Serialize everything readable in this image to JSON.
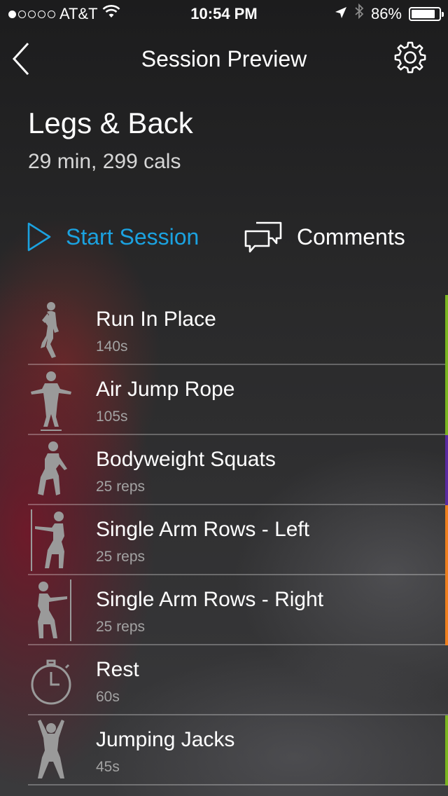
{
  "status_bar": {
    "signal_dots_filled": 1,
    "signal_dots_total": 5,
    "carrier": "AT&T",
    "time": "10:54 PM",
    "battery": "86%",
    "battery_level": 0.86
  },
  "nav": {
    "title": "Session Preview",
    "back_icon": "chevron-left-icon",
    "settings_icon": "gear-icon"
  },
  "workout": {
    "title": "Legs & Back",
    "meta": "29 min, 299 cals"
  },
  "actions": {
    "start_label": "Start Session",
    "comments_label": "Comments",
    "accent_color": "#1ba2e0"
  },
  "exercises": [
    {
      "name": "Run In Place",
      "detail": "140s",
      "figure": "running-figure-icon",
      "strip_color": "#7bb421"
    },
    {
      "name": "Air Jump Rope",
      "detail": "105s",
      "figure": "jump-rope-figure-icon",
      "strip_color": "#7bb421"
    },
    {
      "name": "Bodyweight Squats",
      "detail": "25 reps",
      "figure": "squat-figure-icon",
      "strip_color": "#5a2aa0"
    },
    {
      "name": "Single Arm Rows - Left",
      "detail": "25 reps",
      "figure": "row-left-figure-icon",
      "strip_color": "#ee7f1e"
    },
    {
      "name": "Single Arm Rows - Right",
      "detail": "25 reps",
      "figure": "row-right-figure-icon",
      "strip_color": "#ee7f1e"
    },
    {
      "name": "Rest",
      "detail": "60s",
      "figure": "stopwatch-icon",
      "strip_color": ""
    },
    {
      "name": "Jumping Jacks",
      "detail": "45s",
      "figure": "jumping-jacks-figure-icon",
      "strip_color": "#7bb421"
    }
  ]
}
